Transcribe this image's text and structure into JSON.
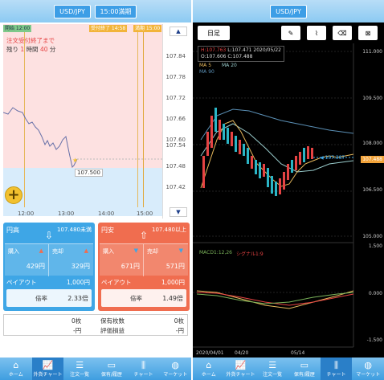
{
  "left": {
    "pair_label": "USD/JPY",
    "period_label": "15:00満期",
    "start_tag": "開始 12:00",
    "deadline_tag": "受付終了 14:58",
    "expiry_tag": "満期 15:00",
    "notice_line1": "注文受付終了まで",
    "notice_prefix": "残り",
    "notice_hours": "1",
    "notice_mid": "時間",
    "notice_minutes": "40",
    "notice_suffix": "分",
    "y_ticks": [
      "107.84",
      "107.78",
      "107.72",
      "107.66",
      "107.60",
      "107.54",
      "107.48",
      "107.42"
    ],
    "x_ticks": [
      "12:00",
      "13:00",
      "14:00",
      "15:00"
    ],
    "current_price": "107.500",
    "high_panel": {
      "title": "円高",
      "strike": "107.480未満",
      "buy_label": "購入",
      "sell_label": "売却",
      "buy_price": "429円",
      "sell_price": "329円",
      "payout_label": "ペイアウト",
      "payout_value": "1,000円",
      "odds_label": "倍率",
      "odds_value": "2.33倍"
    },
    "low_panel": {
      "title": "円安",
      "strike": "107.480以上",
      "buy_label": "購入",
      "sell_label": "売却",
      "buy_price": "671円",
      "sell_price": "571円",
      "payout_label": "ペイアウト",
      "payout_value": "1,000円",
      "odds_label": "倍率",
      "odds_value": "1.49倍"
    },
    "summary": {
      "left_count": "0枚",
      "left_pl": "-円",
      "holdings_label": "保有枚数",
      "holdings_value": "0枚",
      "eval_label": "評価損益",
      "eval_value": "-円"
    }
  },
  "right": {
    "pair_label": "USD/JPY",
    "timeframe": "日足",
    "ohlc_line1_h": "H:107.763",
    "ohlc_line1_l": "L:107.471",
    "ohlc_date": "2020/05/22",
    "ohlc_line2_o": "O:107.606",
    "ohlc_line2_c": "C:107.488",
    "ma5": "MA 5",
    "ma20": "MA 20",
    "ma90": "MA 90",
    "y_ticks": [
      "111.000",
      "109.500",
      "108.000",
      "106.500",
      "105.000"
    ],
    "current_price": "107.488",
    "last_marker": "107.387",
    "macd_label": "MACD1:12,26",
    "signal_label": "シグナル1:9",
    "macd_ticks": [
      "1.500",
      "0.000",
      "-1.500"
    ],
    "x_ticks": [
      "2020/04/01",
      "04/20",
      "05/14"
    ]
  },
  "nav_items": [
    "ホーム",
    "外貨チャート",
    "注文一覧",
    "保有/履歴",
    "チャート",
    "マーケット"
  ],
  "colors": {
    "accent_blue": "#3ea6e6",
    "accent_red": "#f06d4f",
    "nav_active": "#2a7fc8"
  }
}
